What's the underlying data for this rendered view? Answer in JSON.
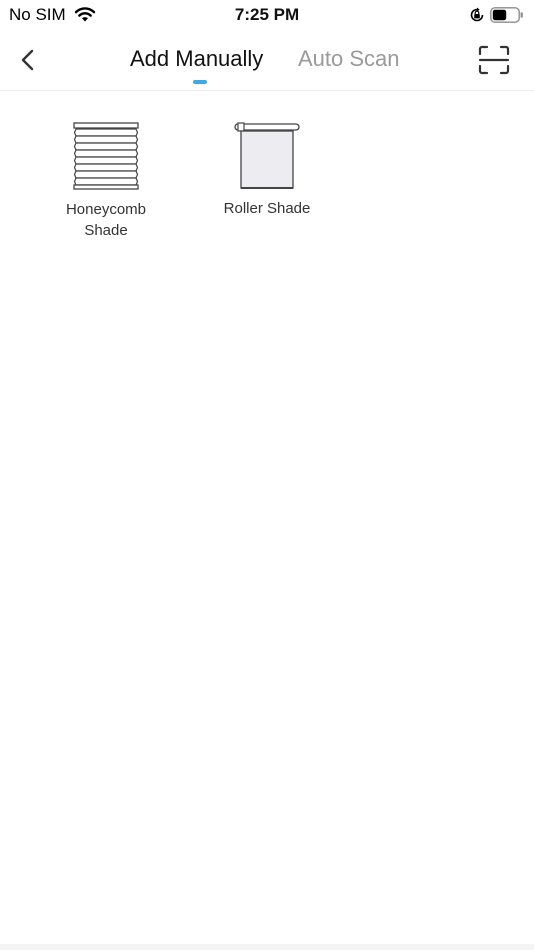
{
  "status_bar": {
    "carrier": "No SIM",
    "time": "7:25 PM",
    "wifi_icon": "wifi-icon",
    "rotation_lock_icon": "rotation-lock-icon",
    "battery_icon": "battery-icon",
    "battery_level": 0.55
  },
  "nav": {
    "back_icon": "chevron-left-icon",
    "tabs": [
      {
        "label": "Add Manually",
        "active": true
      },
      {
        "label": "Auto Scan",
        "active": false
      }
    ],
    "scan_icon": "scan-icon"
  },
  "devices": [
    {
      "label": "Honeycomb Shade",
      "icon": "honeycomb-shade-icon"
    },
    {
      "label": "Roller Shade",
      "icon": "roller-shade-icon"
    }
  ],
  "colors": {
    "accent": "#3ea8e0",
    "active_tab_text": "#111111",
    "inactive_tab_text": "#9a9a9a",
    "background": "#ffffff"
  }
}
